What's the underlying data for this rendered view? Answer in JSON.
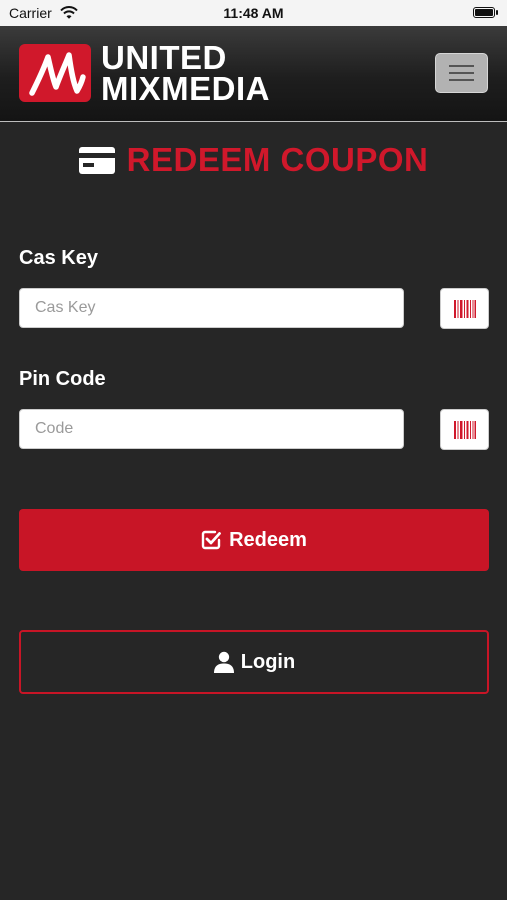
{
  "status_bar": {
    "carrier": "Carrier",
    "time": "11:48 AM"
  },
  "header": {
    "logo_line1": "UNITED",
    "logo_line2": "MIXMEDIA"
  },
  "page": {
    "title": "REDEEM COUPON"
  },
  "form": {
    "cas_key": {
      "label": "Cas Key",
      "placeholder": "Cas Key",
      "value": ""
    },
    "pin_code": {
      "label": "Pin Code",
      "placeholder": "Code",
      "value": ""
    }
  },
  "buttons": {
    "redeem": "Redeem",
    "login": "Login"
  },
  "colors": {
    "brand_red": "#c81526",
    "background": "#262626"
  }
}
